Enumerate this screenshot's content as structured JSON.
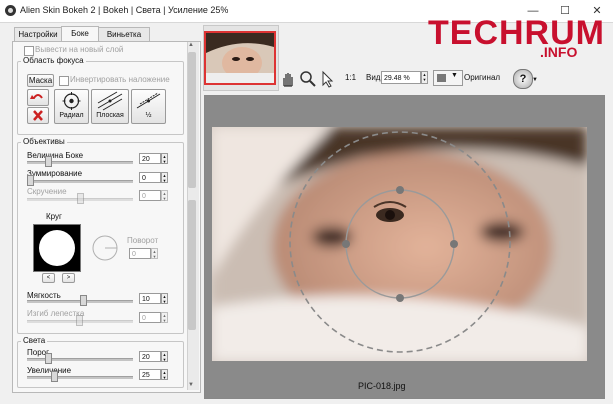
{
  "window": {
    "title": "Alien Skin Bokeh 2 | Bokeh | Света | Усиление 25%",
    "minimize": "—",
    "maximize": "☐",
    "close": "✕"
  },
  "watermark": {
    "text": "TECHRUM",
    "sub": ".INFO"
  },
  "tabs": [
    {
      "label": "Настройки"
    },
    {
      "label": "Боке"
    },
    {
      "label": "Виньетка"
    }
  ],
  "panel": {
    "new_layer_label": "Вывести на новый слой",
    "focus_group": {
      "title": "Область фокуса",
      "mask_button": "Маска",
      "invert_label": "Инвертировать наложение",
      "radial_label": "Радиал",
      "flat_label": "Плоская",
      "half_label": "½"
    },
    "lens_group": {
      "title": "Объективы",
      "bokeh_amount_label": "Величина Боке",
      "bokeh_amount_value": "20",
      "zoom_label": "Зуммирование",
      "zoom_value": "0",
      "twist_label": "Скручение",
      "twist_value": "0",
      "shape_label": "Круг",
      "rotation_label": "Поворот",
      "rotation_value": "0",
      "prev_shape": "<",
      "next_shape": ">",
      "softness_label": "Мягкость",
      "softness_value": "10",
      "petal_label": "Изгиб лепестка",
      "petal_value": "0"
    },
    "lights_group": {
      "title": "Света",
      "threshold_label": "Порог",
      "threshold_value": "20",
      "boost_label": "Увеличение",
      "boost_value": "25"
    }
  },
  "toolbar": {
    "hand_icon": "hand-icon",
    "zoom_icon": "zoom-icon",
    "pointer_icon": "pointer-icon",
    "one_to_one": "1:1",
    "view_label": "Вид",
    "zoom_value": "29.48 %",
    "original_label": "Оригинал",
    "help_icon": "?"
  },
  "preview": {
    "filename": "PIC-018.jpg"
  }
}
